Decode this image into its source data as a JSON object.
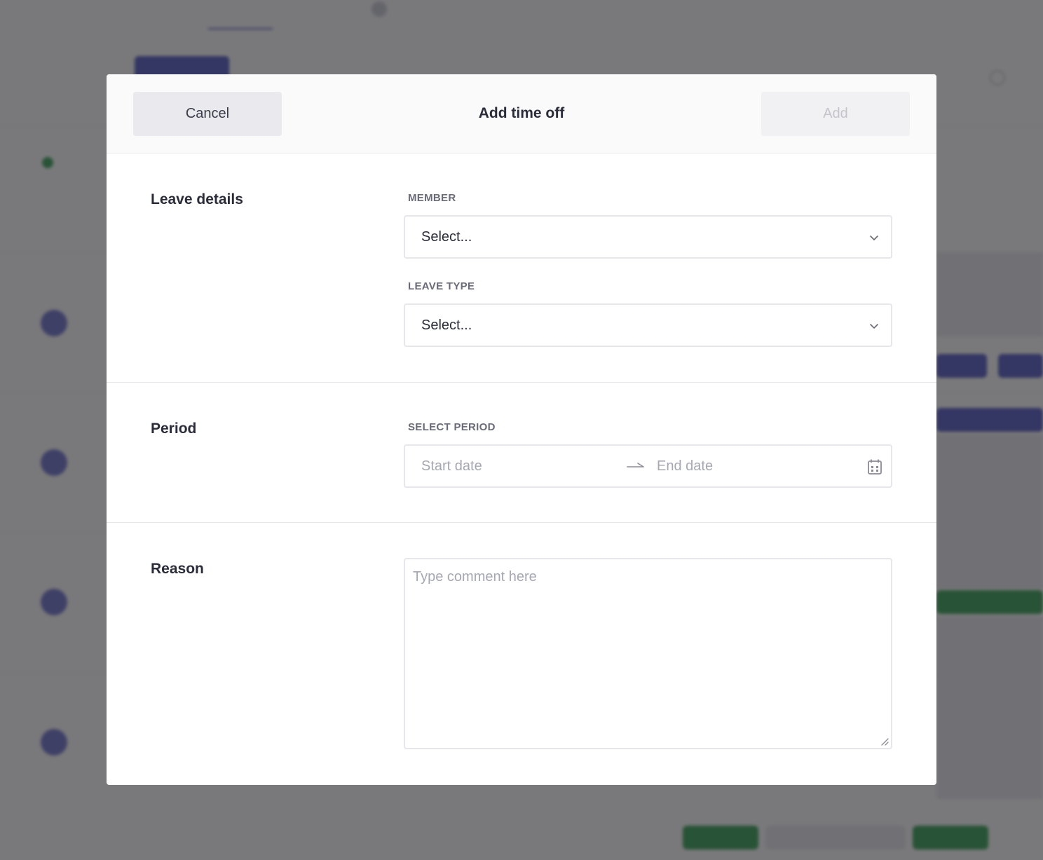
{
  "modal": {
    "title": "Add time off",
    "cancel_label": "Cancel",
    "add_label": "Add"
  },
  "leave_details": {
    "heading": "Leave details",
    "member": {
      "label": "MEMBER",
      "value": "Select..."
    },
    "leave_type": {
      "label": "LEAVE TYPE",
      "value": "Select..."
    }
  },
  "period": {
    "heading": "Period",
    "label": "SELECT PERIOD",
    "start_placeholder": "Start date",
    "end_placeholder": "End date"
  },
  "reason": {
    "heading": "Reason",
    "placeholder": "Type comment here"
  },
  "colors": {
    "primary": "#4b4fbf",
    "success": "#2e9b4a",
    "overlay": "rgba(38,38,42,0.62)"
  },
  "icons": [
    "chevron-down-icon",
    "arrow-right-icon",
    "calendar-icon",
    "resize-grip-icon"
  ]
}
